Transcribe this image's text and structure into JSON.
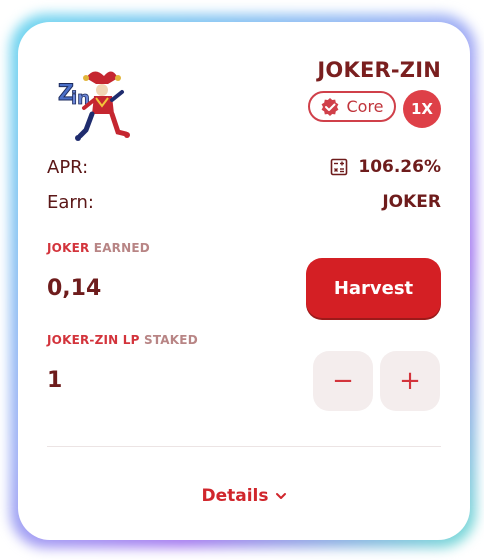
{
  "farm": {
    "logo_icon": "joker-zin-logo",
    "pair_name": "JOKER-ZIN",
    "core_badge_label": "Core",
    "multiplier": "1X",
    "apr_label": "APR:",
    "apr_value": "106.26%",
    "calculator_icon": "calculator-icon",
    "earn_label": "Earn:",
    "earn_value": "JOKER",
    "earned_token": "JOKER",
    "earned_suffix": "EARNED",
    "earned_amount": "0,14",
    "harvest_label": "Harvest",
    "staked_token": "JOKER-ZIN LP",
    "staked_suffix": "STAKED",
    "staked_amount": "1",
    "minus_symbol": "−",
    "plus_symbol": "+",
    "details_label": "Details"
  },
  "colors": {
    "accent": "#d41f24",
    "text_dark": "#6e1c1c",
    "badge_red": "#de4048",
    "stepper_bg": "#f4eded"
  }
}
